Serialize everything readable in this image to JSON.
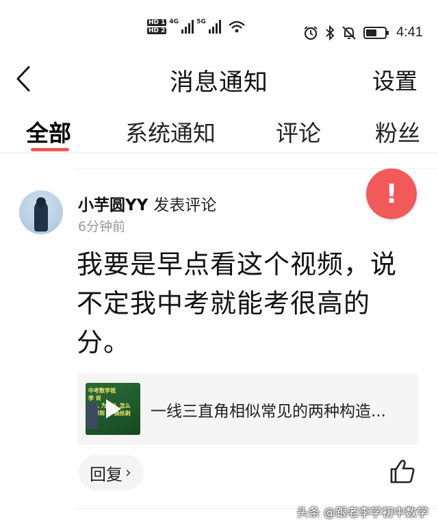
{
  "status_bar": {
    "hd1": "HD 1",
    "hd2": "HD 2",
    "net1": "4G",
    "net2": "5G",
    "time": "4:41"
  },
  "header": {
    "title": "消息通知",
    "settings_label": "设置"
  },
  "tabs": [
    {
      "label": "全部",
      "active": true
    },
    {
      "label": "系统通知",
      "active": false
    },
    {
      "label": "评论",
      "active": false
    },
    {
      "label": "粉丝",
      "active": false
    }
  ],
  "notification": {
    "author": "小芋圆YY",
    "action": "发表评论",
    "time_ago": "6分钟前",
    "comment_lines": [
      "我要是早点看这个视频，说",
      "不定我中考就能考很高的",
      "分。"
    ],
    "alert_symbol": "!",
    "video": {
      "title": "一线三直角相似常见的两种构造...",
      "thumbnail_text": [
        "中考数学视",
        "李 说",
        "什么 为什么 怎么",
        "何想到 — 抽丝剥"
      ]
    },
    "reply_label": "回复",
    "reply_chevron": "›"
  },
  "watermark": "头条 @跟老李学初中数学",
  "colors": {
    "accent": "#e85a5a",
    "alert": "#f25a5a"
  }
}
